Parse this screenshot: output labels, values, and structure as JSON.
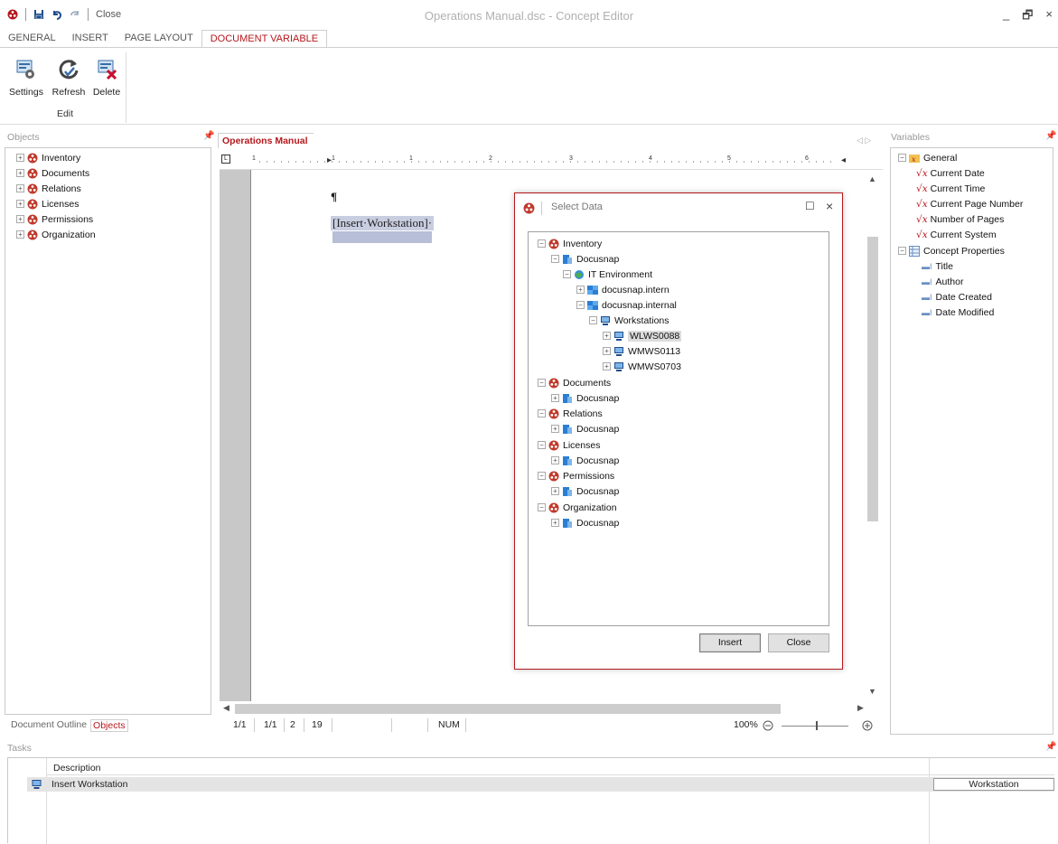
{
  "window": {
    "title": "Operations Manual.dsc - Concept Editor",
    "qat_close": "Close",
    "minimize": "_",
    "restore": "🗗",
    "close": "×"
  },
  "ribbon": {
    "tabs": [
      "GENERAL",
      "INSERT",
      "PAGE LAYOUT",
      "DOCUMENT VARIABLE"
    ],
    "active_tab": "DOCUMENT VARIABLE",
    "buttons": {
      "settings": "Settings",
      "refresh": "Refresh",
      "delete": "Delete"
    },
    "group_label": "Edit"
  },
  "objects_pane": {
    "title": "Objects",
    "items": [
      "Inventory",
      "Documents",
      "Relations",
      "Licenses",
      "Permissions",
      "Organization"
    ],
    "bottom_tabs": {
      "outline": "Document Outline",
      "objects": "Objects"
    }
  },
  "document": {
    "tab": "Operations Manual",
    "pilcrow": "¶",
    "field": "[Insert·Workstation]·",
    "ruler_numbers": [
      "1",
      "1",
      "2",
      "3",
      "4",
      "5",
      "6"
    ]
  },
  "statusbar": {
    "page": "1/1",
    "section": "1/1",
    "line": "2",
    "col": "19",
    "num": "NUM",
    "zoom": "100%"
  },
  "dialog": {
    "title": "Select Data",
    "tree": [
      {
        "label": "Inventory",
        "icon": "docusnap-icon"
      },
      {
        "label": "Docusnap",
        "icon": "docusnap-db-icon"
      },
      {
        "label": "IT Environment",
        "icon": "globe-icon"
      },
      {
        "label": "docusnap.intern",
        "icon": "domain-icon"
      },
      {
        "label": "docusnap.internal",
        "icon": "domain-icon"
      },
      {
        "label": "Workstations",
        "icon": "computer-icon"
      },
      {
        "label": "WLWS0088",
        "icon": "computer-icon"
      },
      {
        "label": "WMWS0113",
        "icon": "computer-icon"
      },
      {
        "label": "WMWS0703",
        "icon": "computer-icon"
      },
      {
        "label": "Documents",
        "icon": "docusnap-icon"
      },
      {
        "label": "Docusnap",
        "icon": "docusnap-db-icon"
      },
      {
        "label": "Relations",
        "icon": "docusnap-icon"
      },
      {
        "label": "Docusnap",
        "icon": "docusnap-db-icon"
      },
      {
        "label": "Licenses",
        "icon": "docusnap-icon"
      },
      {
        "label": "Docusnap",
        "icon": "docusnap-db-icon"
      },
      {
        "label": "Permissions",
        "icon": "docusnap-icon"
      },
      {
        "label": "Docusnap",
        "icon": "docusnap-db-icon"
      },
      {
        "label": "Organization",
        "icon": "docusnap-icon"
      },
      {
        "label": "Docusnap",
        "icon": "docusnap-db-icon"
      }
    ],
    "selected": "WLWS0088",
    "insert_button": "Insert",
    "close_button": "Close"
  },
  "variables_pane": {
    "title": "Variables",
    "general": "General",
    "general_items": [
      "Current Date",
      "Current Time",
      "Current Page Number",
      "Number of Pages",
      "Current System"
    ],
    "concept": "Concept Properties",
    "concept_items": [
      "Title",
      "Author",
      "Date Created",
      "Date Modified"
    ]
  },
  "tasks": {
    "title": "Tasks",
    "column": "Description",
    "rows": [
      {
        "description": "Insert Workstation",
        "type": "Workstation"
      }
    ]
  },
  "colors": {
    "accent": "#b5171c",
    "selection": "#c8cde0"
  }
}
